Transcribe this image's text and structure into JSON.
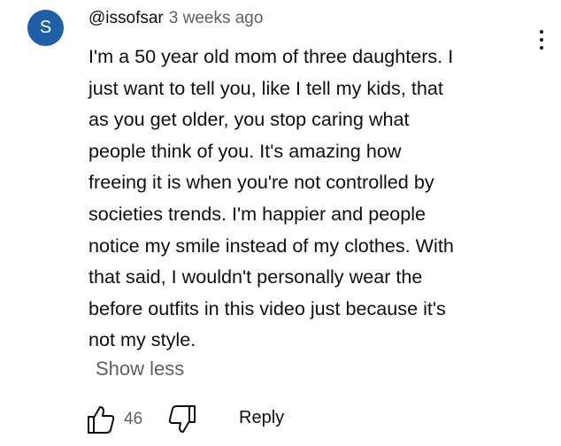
{
  "comment": {
    "avatar_letter": "S",
    "avatar_color": "#1f5fa8",
    "author": "@issofsar",
    "timestamp": "3 weeks ago",
    "body_lines": [
      "I'm a 50 year old mom of three daughters. I",
      "just want to tell you, like I tell my kids, that",
      "as you get older, you stop caring what",
      "people think of you. It's amazing how",
      "freeing it is when you're not controlled by",
      "societies trends. I'm happier and people",
      "notice my smile instead of my clothes. With",
      "that said, I wouldn't personally wear the",
      "before outfits in this video just because it's",
      "not my style."
    ],
    "show_less_label": "Show less",
    "like_count": "46",
    "reply_label": "Reply",
    "icons": {
      "menu": "more-vert-icon",
      "like": "thumb-up-icon",
      "dislike": "thumb-down-icon"
    }
  }
}
